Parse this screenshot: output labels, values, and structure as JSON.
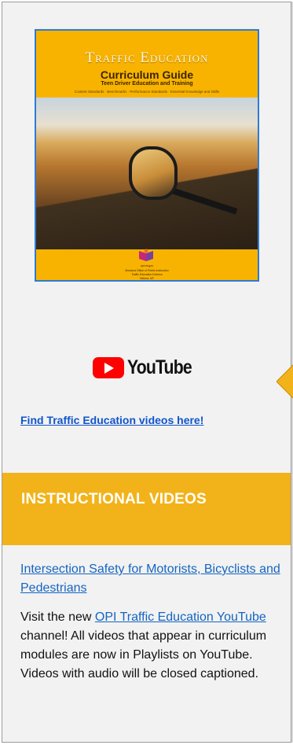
{
  "cover": {
    "title": "Traffic Education",
    "subtitle": "Curriculum Guide",
    "subtitle2": "Teen Driver Education and Training",
    "tagline": "Content Standards · Benchmarks · Performance Standards · Essential Knowledge and Skills",
    "site": "opi.mt.gov",
    "footer1": "Montana Office of Public Instruction",
    "footer2": "Traffic Education Division",
    "footer3": "Helena, MT"
  },
  "youtube": {
    "wordmark": "YouTube",
    "link_text": "Find Traffic Education videos here!"
  },
  "section": {
    "heading": "INSTRUCTIONAL VIDEOS",
    "video_link": "Intersection Safety for Motorists, Bicyclists and Pedestrians",
    "para_before": "Visit the new ",
    "channel_link": "OPI Traffic Education YouTube",
    "para_after": " channel! All videos that appear in curriculum modules are now in Playlists on YouTube. Videos with audio will be closed captioned."
  },
  "colors": {
    "band": "#f2b31a",
    "link": "#1565c0",
    "youtube_red": "#ff0000"
  },
  "icons": [
    "youtube-play-icon",
    "expand-arrow-icon",
    "opi-logo-icon"
  ]
}
